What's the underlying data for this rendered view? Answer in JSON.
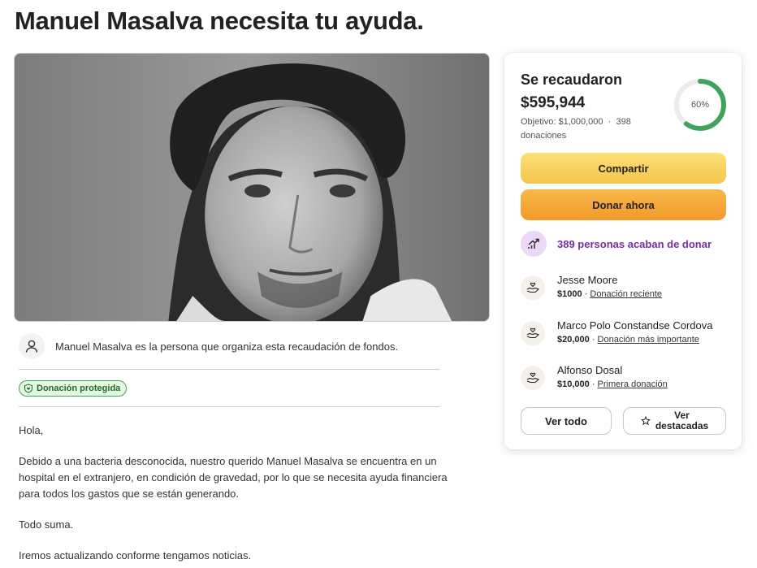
{
  "page": {
    "title": "Manuel Masalva necesita tu ayuda."
  },
  "organizer": {
    "text": "Manuel Masalva es la persona que organiza esta recaudación de fondos.",
    "icon": "user-icon"
  },
  "badge": {
    "label": "Donación protegida",
    "icon": "shield-heart-icon",
    "color": "#1e6b2d"
  },
  "story": {
    "paragraphs": [
      "Hola,",
      "Debido a una bacteria desconocida, nuestro querido Manuel Masalva se encuentra en un hospital en el extranjero, en condición de gravedad, por lo que se necesita ayuda financiera para todos los gastos que se están generando.",
      "Todo suma.",
      "Iremos actualizando conforme tengamos noticias."
    ]
  },
  "card": {
    "raised_label": "Se recaudaron",
    "raised_amount": "$595,944",
    "goal_text": "Objetivo: $1,000,000",
    "separator": "·",
    "donations_text": "398 donaciones",
    "progress_label": "60%",
    "progress_value": 0.6,
    "progress_color": "#3fa35b",
    "share_label": "Compartir",
    "donate_label": "Donar ahora",
    "recent_text": "389 personas acaban de donar",
    "recent_icon": "trending-up-icon",
    "recent_color": "#7a2ba8",
    "donors": [
      {
        "name": "Jesse Moore",
        "amount": "$1000",
        "sep": " · ",
        "tag": "Donación reciente",
        "icon": "hand-heart-icon"
      },
      {
        "name": "Marco Polo Constandse Cordova",
        "amount": "$20,000",
        "sep": " · ",
        "tag": "Donación más importante",
        "icon": "hand-heart-icon"
      },
      {
        "name": "Alfonso Dosal",
        "amount": "$10,000",
        "sep": " · ",
        "tag": "Primera donación",
        "icon": "hand-heart-icon"
      }
    ],
    "see_all_label": "Ver todo",
    "see_featured_label_1": "Ver",
    "see_featured_label_2": "destacadas",
    "featured_icon": "star-icon"
  }
}
